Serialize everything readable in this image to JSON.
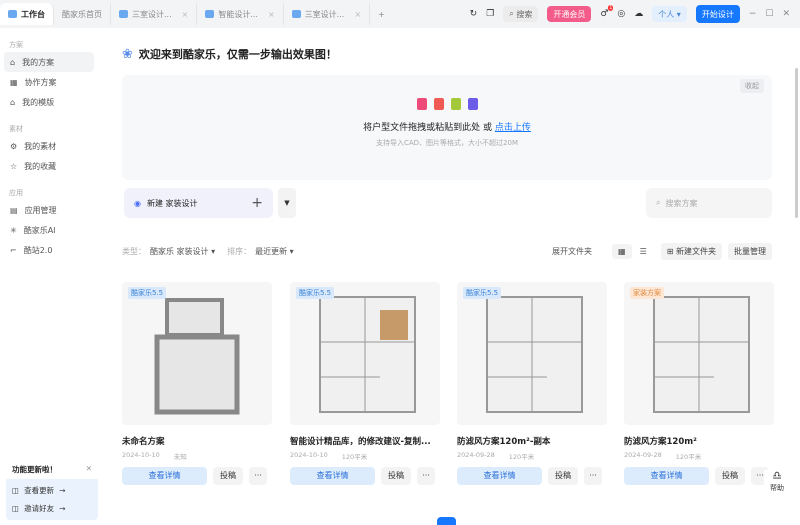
{
  "tabs": [
    {
      "label": "工作台"
    },
    {
      "label": "酷家乐首页"
    },
    {
      "label": "三室设计..."
    },
    {
      "label": "智能设计..."
    },
    {
      "label": "三室设计..."
    }
  ],
  "topbar": {
    "search": "搜索",
    "vip": "开通会员",
    "notif_count": "1",
    "user": "个人",
    "start": "开始设计",
    "accent": "#1677ff"
  },
  "sidebar": {
    "sections": [
      {
        "title": "方案",
        "items": [
          {
            "label": "我的方案",
            "icon": "home-icon"
          },
          {
            "label": "协作方案",
            "icon": "team-icon"
          },
          {
            "label": "我的模版",
            "icon": "template-icon"
          }
        ]
      },
      {
        "title": "素材",
        "items": [
          {
            "label": "我的素材",
            "icon": "gear-icon"
          },
          {
            "label": "我的收藏",
            "icon": "star-icon"
          }
        ]
      },
      {
        "title": "应用",
        "items": [
          {
            "label": "应用管理",
            "icon": "apps-icon"
          },
          {
            "label": "酷家乐AI",
            "icon": "ai-icon"
          },
          {
            "label": "酷站2.0",
            "icon": "site-icon"
          }
        ]
      }
    ]
  },
  "welcome": "欢迎来到酷家乐，仅需一步输出效果图！",
  "upload": {
    "collapse": "收起",
    "text": "将户型文件拖拽或粘贴到此处 或",
    "link": "点击上传",
    "hint": "支持导入CAD、图片等格式，大小不超过20M"
  },
  "create": {
    "label": "新建 家装设计"
  },
  "search_placeholder": "搜索方案",
  "filters": {
    "type_label": "类型：",
    "type_value": "酷家乐 家装设计",
    "sort_label": "排序：",
    "sort_value": "最近更新",
    "expand": "展开文件夹",
    "new_folder": "新建文件夹",
    "batch": "批量管理"
  },
  "cards": [
    {
      "badge": "酷家乐5.5",
      "title": "未命名方案",
      "date": "2024-10-10",
      "area": "未知"
    },
    {
      "badge": "酷家乐5.5",
      "title": "智能设计精品库，的修改建议-复制...",
      "date": "2024-10-10",
      "area": "120平米"
    },
    {
      "badge": "酷家乐5.5",
      "title": "防滤风方案120m²-副本",
      "date": "2024-09-28",
      "area": "120平米"
    },
    {
      "badge": "家装方案",
      "title": "防滤风方案120m²",
      "date": "2024-09-28",
      "area": "120平米"
    }
  ],
  "card_buttons": {
    "view": "查看详情",
    "submit": "投稿",
    "more": "···"
  },
  "notice": {
    "title": "功能更新啦！",
    "items": [
      "查看更新",
      "邀请好友"
    ]
  },
  "help": "帮助"
}
